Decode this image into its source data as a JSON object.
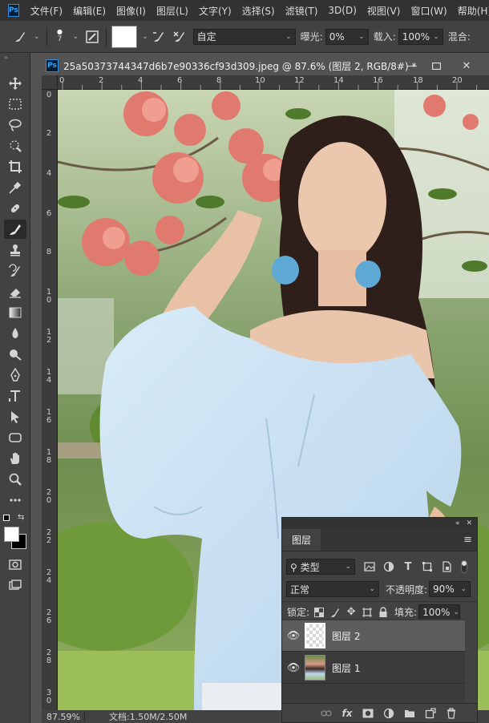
{
  "menubar": {
    "items": [
      "文件(F)",
      "编辑(E)",
      "图像(I)",
      "图层(L)",
      "文字(Y)",
      "选择(S)",
      "滤镜(T)",
      "3D(D)",
      "视图(V)",
      "窗口(W)",
      "帮助(H)"
    ],
    "logo": "Ps"
  },
  "options": {
    "brush_size": "7",
    "mode_value": "自定",
    "exposure_label": "曝光:",
    "exposure_value": "0%",
    "flow_label": "载入:",
    "flow_value": "100%",
    "mix_label": "混合:"
  },
  "document": {
    "logo": "Ps",
    "title": "25a50373744347d6b7e90336cf93d309.jpeg @ 87.6% (图层 2, RGB/8#) *",
    "ruler_top": [
      "0",
      "2",
      "4",
      "6",
      "8",
      "10",
      "12",
      "14",
      "16",
      "18",
      "20"
    ],
    "ruler_left": [
      "0",
      "2",
      "4",
      "6",
      "8",
      "10",
      "12",
      "14",
      "16",
      "18",
      "20",
      "22",
      "24",
      "26",
      "28",
      "30"
    ],
    "zoom": "87.59%",
    "doc_size": "文档:1.50M/2.50M"
  },
  "layers_panel": {
    "tab": "图层",
    "filter_kind": "类型",
    "blend_mode": "正常",
    "opacity_label": "不透明度:",
    "opacity_value": "90%",
    "lock_label": "锁定:",
    "fill_label": "填充:",
    "fill_value": "100%",
    "layers": [
      {
        "name": "图层 2",
        "selected": true,
        "visible": true
      },
      {
        "name": "图层 1",
        "selected": false,
        "visible": true
      }
    ]
  },
  "colors": {
    "app_bg": "#535353",
    "panel_bg": "#424242",
    "menubar_bg": "#323232",
    "accent": "#31a8ff"
  }
}
